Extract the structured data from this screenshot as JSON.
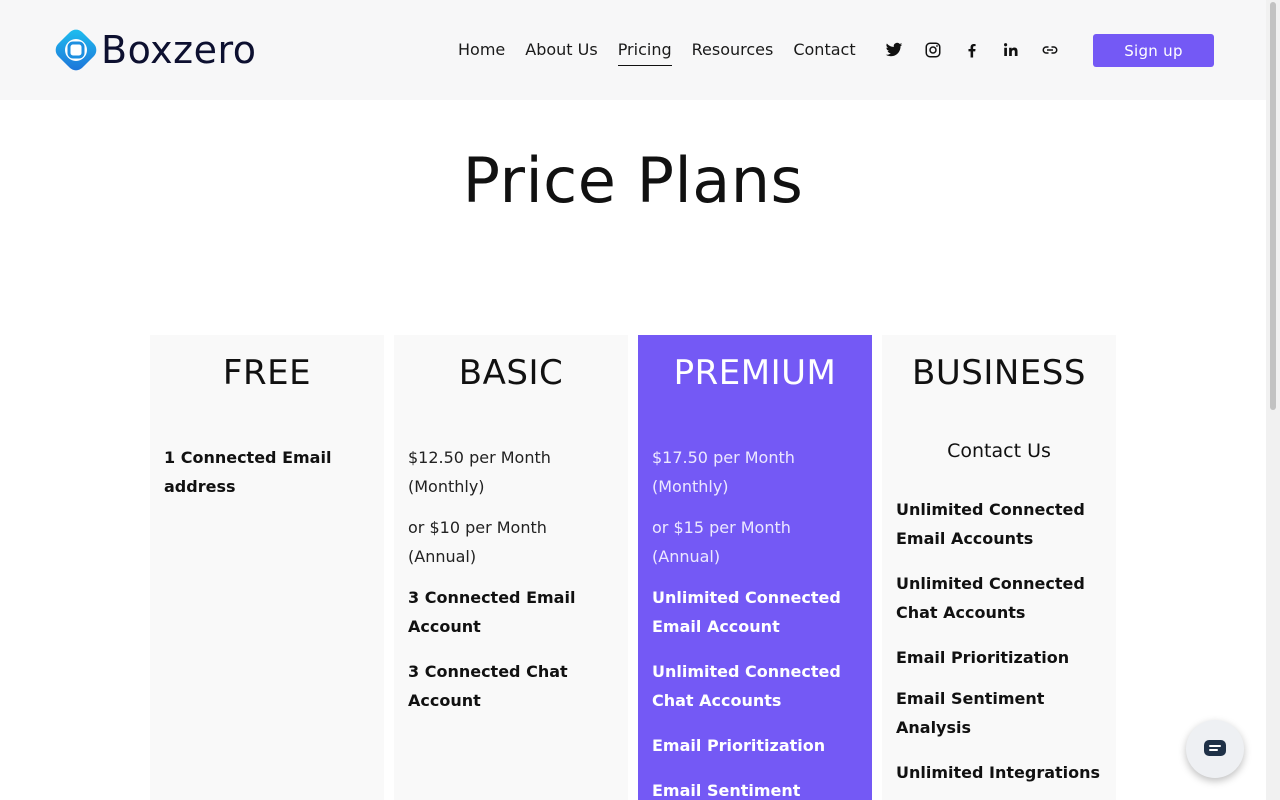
{
  "brand": {
    "name": "Boxzero",
    "logo_icon": "boxzero-logo-icon",
    "color": "#0d1030",
    "accent": "#2b9be6"
  },
  "nav": {
    "items": [
      {
        "label": "Home",
        "active": false
      },
      {
        "label": "About Us",
        "active": false
      },
      {
        "label": "Pricing",
        "active": true
      },
      {
        "label": "Resources",
        "active": false
      },
      {
        "label": "Contact",
        "active": false
      }
    ]
  },
  "socials": [
    "twitter-icon",
    "instagram-icon",
    "facebook-icon",
    "linkedin-icon",
    "link-icon"
  ],
  "signup": {
    "label": "Sign up",
    "color": "#7459f5"
  },
  "page": {
    "title": "Price Plans"
  },
  "plans": [
    {
      "name": "FREE",
      "prices": [],
      "features": [
        "1 Connected Email address"
      ]
    },
    {
      "name": "BASIC",
      "prices": [
        "$12.50 per Month (Monthly)",
        "or $10 per Month (Annual)"
      ],
      "features": [
        "3 Connected Email Account",
        "3 Connected Chat Account"
      ]
    },
    {
      "name": "PREMIUM",
      "highlighted": true,
      "prices": [
        "$17.50 per Month (Monthly)",
        "or $15 per Month (Annual)"
      ],
      "features": [
        "Unlimited Connected Email Account",
        "Unlimited Connected Chat Accounts",
        "Email Prioritization",
        "Email Sentiment Analysis"
      ]
    },
    {
      "name": "BUSINESS",
      "contact": "Contact Us",
      "prices": [],
      "features": [
        "Unlimited Connected Email Accounts",
        "Unlimited Connected Chat Accounts",
        "Email Prioritization",
        "Email Sentiment Analysis",
        "Unlimited Integrations"
      ]
    }
  ],
  "chat_widget": {
    "icon": "chat-icon"
  }
}
